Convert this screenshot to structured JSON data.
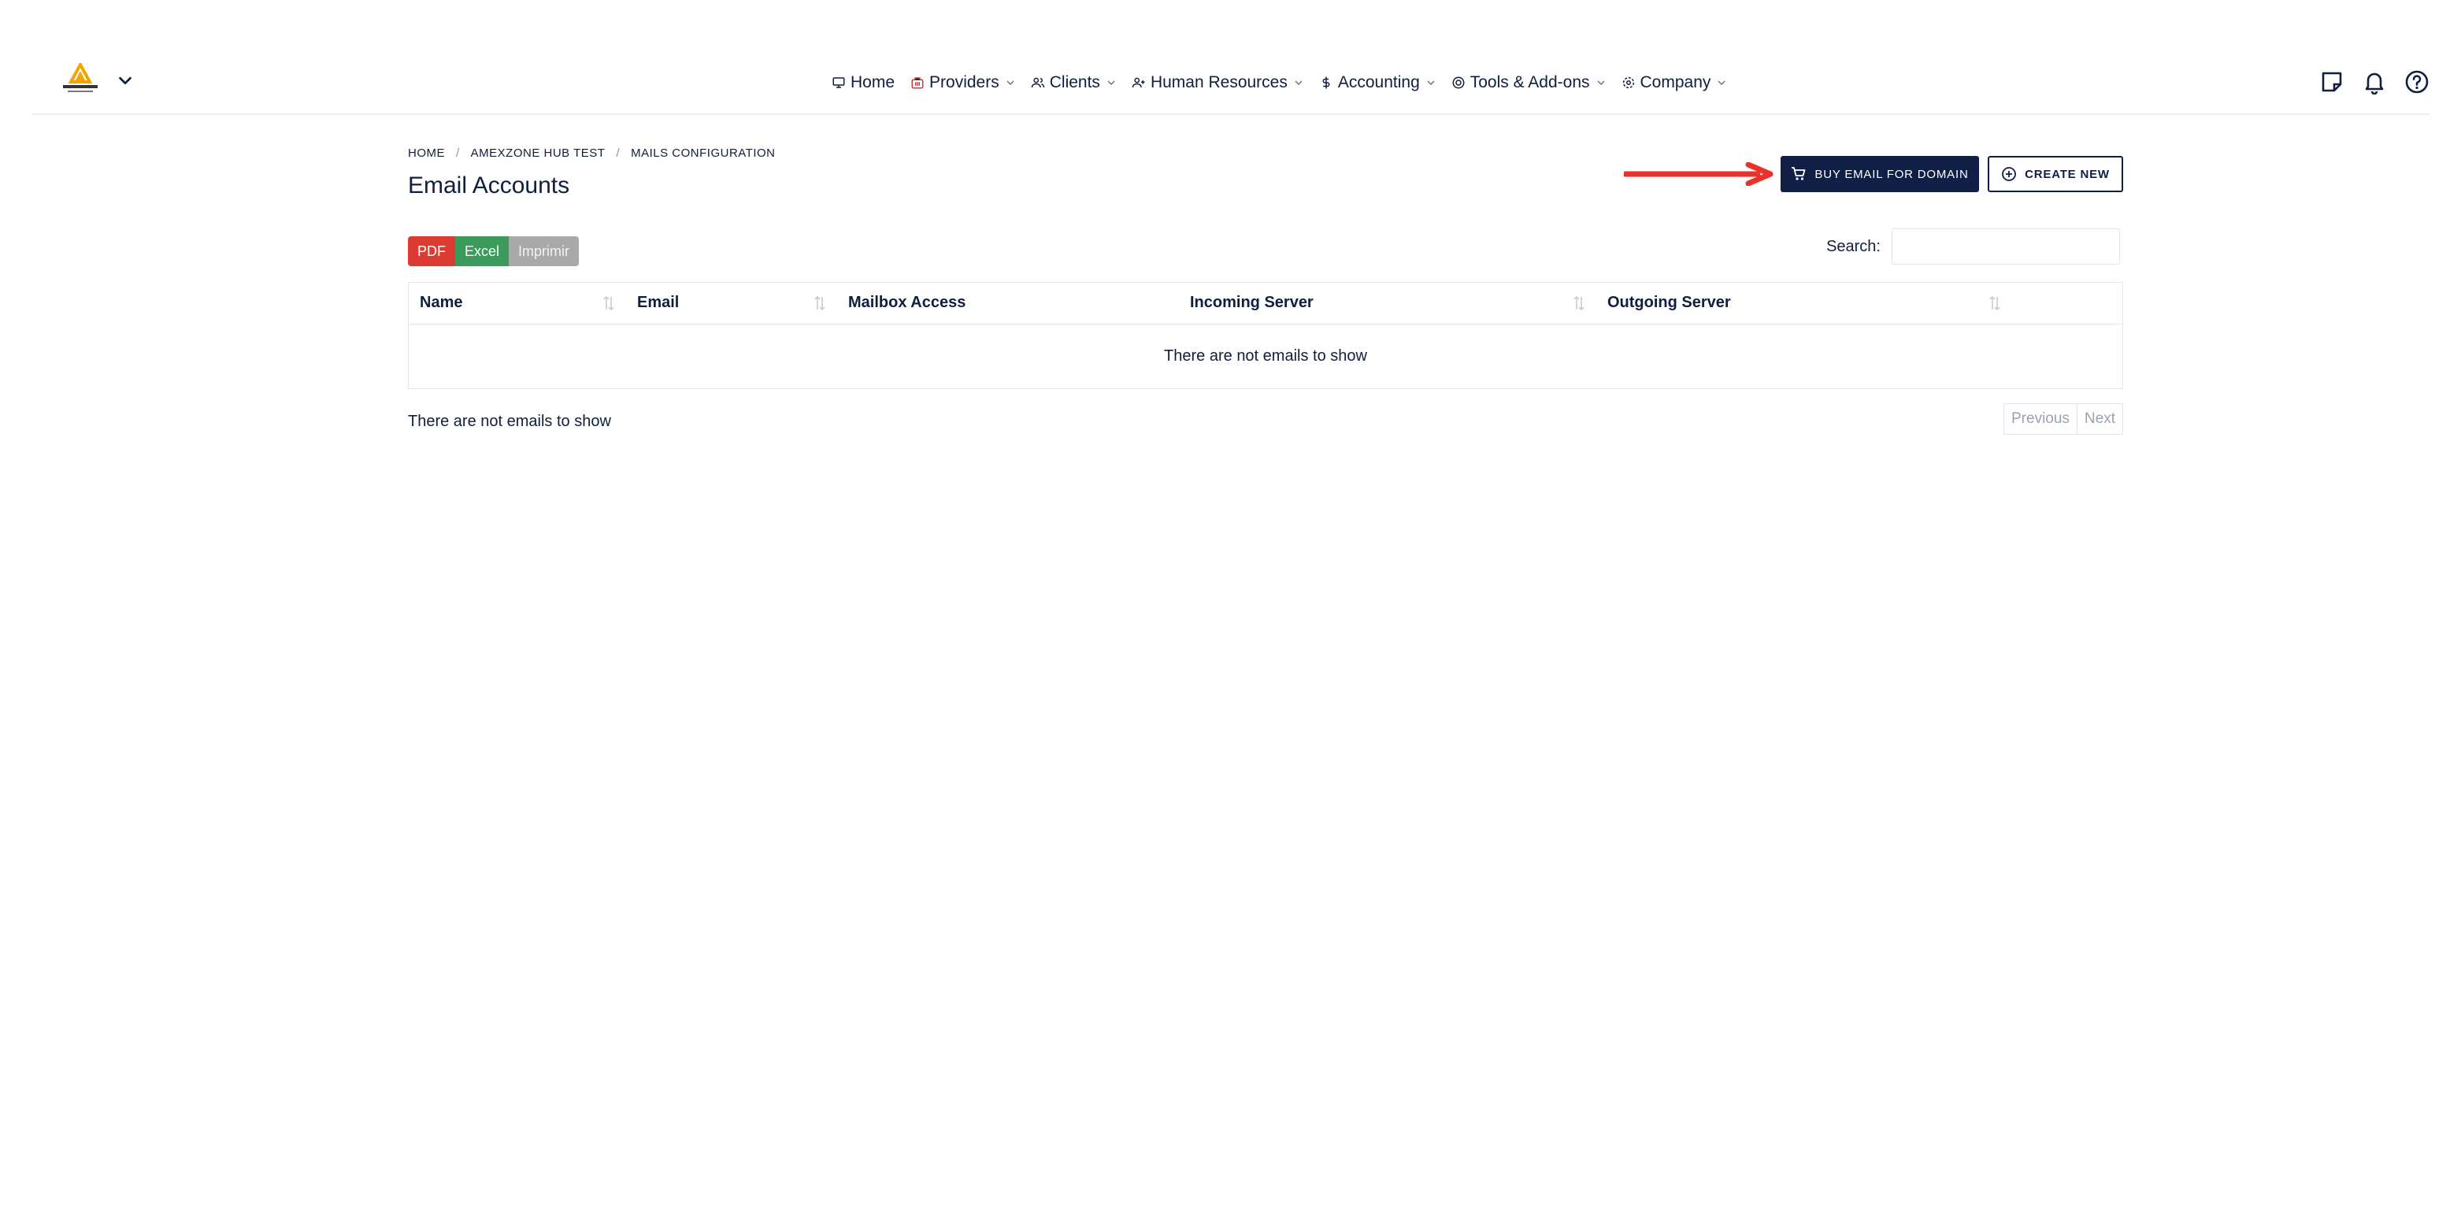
{
  "topnav": {
    "items": [
      {
        "label": "Home",
        "icon": "monitor-icon",
        "has_dropdown": false
      },
      {
        "label": "Providers",
        "icon": "building-icon",
        "has_dropdown": true
      },
      {
        "label": "Clients",
        "icon": "users-icon",
        "has_dropdown": true
      },
      {
        "label": "Human Resources",
        "icon": "user-plus-icon",
        "has_dropdown": true
      },
      {
        "label": "Accounting",
        "icon": "dollar-icon",
        "has_dropdown": true
      },
      {
        "label": "Tools & Add-ons",
        "icon": "at-sign-icon",
        "has_dropdown": true
      },
      {
        "label": "Company",
        "icon": "gear-icon",
        "has_dropdown": true
      }
    ],
    "right_icons": [
      "sticky-note-icon",
      "bell-icon",
      "help-circle-icon"
    ]
  },
  "breadcrumb": [
    "HOME",
    "AMEXZONE HUB TEST",
    "MAILS CONFIGURATION"
  ],
  "page_title": "Email Accounts",
  "actions": {
    "buy_label": "BUY EMAIL FOR DOMAIN",
    "create_label": "CREATE NEW"
  },
  "export_buttons": {
    "pdf": "PDF",
    "excel": "Excel",
    "print": "Imprimir"
  },
  "search": {
    "label": "Search:",
    "value": ""
  },
  "table": {
    "columns": [
      "Name",
      "Email",
      "Mailbox Access",
      "Incoming Server",
      "Outgoing Server"
    ],
    "empty_message": "There are not emails to show"
  },
  "footer": {
    "info": "There are not emails to show",
    "previous": "Previous",
    "next": "Next"
  },
  "colors": {
    "primary": "#0f1f45",
    "pdf": "#dc3b31",
    "excel": "#3a9b5c",
    "print": "#a9a9a9",
    "annotation_arrow": "#e8322b",
    "logo_accent": "#f0a500"
  }
}
